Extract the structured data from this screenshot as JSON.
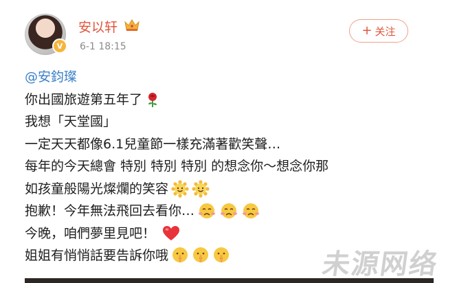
{
  "post": {
    "author": "安以轩",
    "verified_badge": "V",
    "time": "6-1 18:15",
    "follow_label": "关注",
    "follow_plus": "+",
    "mention": "@安鈞璨",
    "lines": [
      "你出國旅遊第五年了",
      "我想「天堂國」",
      "一定天天都像6.1兒童節一樣充滿著歡笑聲…",
      "每年的今天總會 特別 特別 特別 的想念你～想念你那",
      "如孩童般陽光燦爛的笑容",
      "抱歉！今年無法飛回去看你…",
      "今晚，咱們夢里見吧！",
      "姐姐有悄悄話要告訴你哦"
    ],
    "icons": {
      "crown": "crown-icon",
      "rose": "rose-emoji",
      "sun": "sun-smile-emoji",
      "sad": "sad-face-emoji",
      "heart": "red-heart-emoji",
      "shush": "shush-face-emoji"
    }
  },
  "watermark": "未源网络",
  "colors": {
    "username": "#e0543a",
    "mention": "#3b80c8",
    "follow_border": "#f0a089",
    "emoji_yellow": "#f7c842",
    "heart": "#e8333a"
  }
}
